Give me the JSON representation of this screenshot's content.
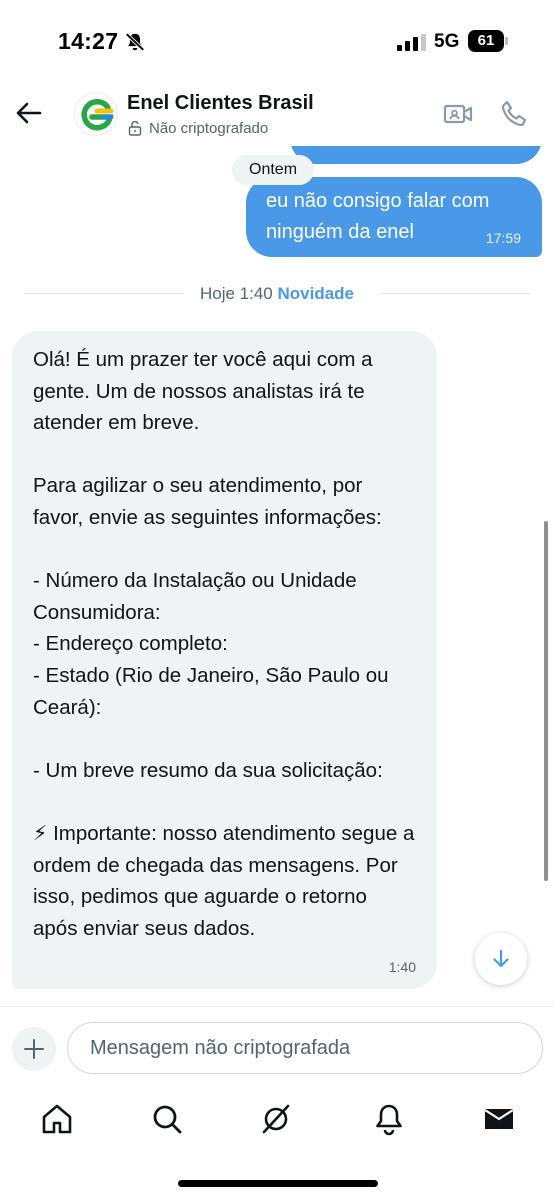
{
  "status_bar": {
    "time": "14:27",
    "network": "5G",
    "battery": "61"
  },
  "header": {
    "contact_name": "Enel Clientes Brasil",
    "encryption_status": "Não criptografado"
  },
  "messages": {
    "date_pill": "Ontem",
    "outgoing": {
      "text": "eu não consigo falar com ninguém da enel",
      "time": "17:59"
    },
    "divider": {
      "time": "Hoje 1:40",
      "label": "Novidade"
    },
    "incoming": {
      "text": "Olá! É um prazer ter você aqui com a gente. Um de nossos analistas irá te atender em breve.\n\nPara agilizar o seu atendimento, por favor, envie as seguintes informações:\n\n- Número da Instalação ou Unidade Consumidora:\n- Endereço completo:\n- Estado (Rio de Janeiro, São Paulo ou Ceará):\n\n- Um breve resumo da sua solicitação:\n\n⚡ Importante: nosso atendimento segue a ordem de chegada das mensagens. Por isso, pedimos que aguarde o retorno após enviar seus dados.",
      "time": "1:40"
    }
  },
  "composer": {
    "placeholder": "Mensagem não criptografada"
  },
  "colors": {
    "accent": "#4a99e9",
    "incoming_bubble": "#eff3f4",
    "text": "#0f1419",
    "muted": "#536471"
  },
  "tabs": [
    "home-icon",
    "search-icon",
    "grok-icon",
    "notifications-icon",
    "messages-icon"
  ]
}
